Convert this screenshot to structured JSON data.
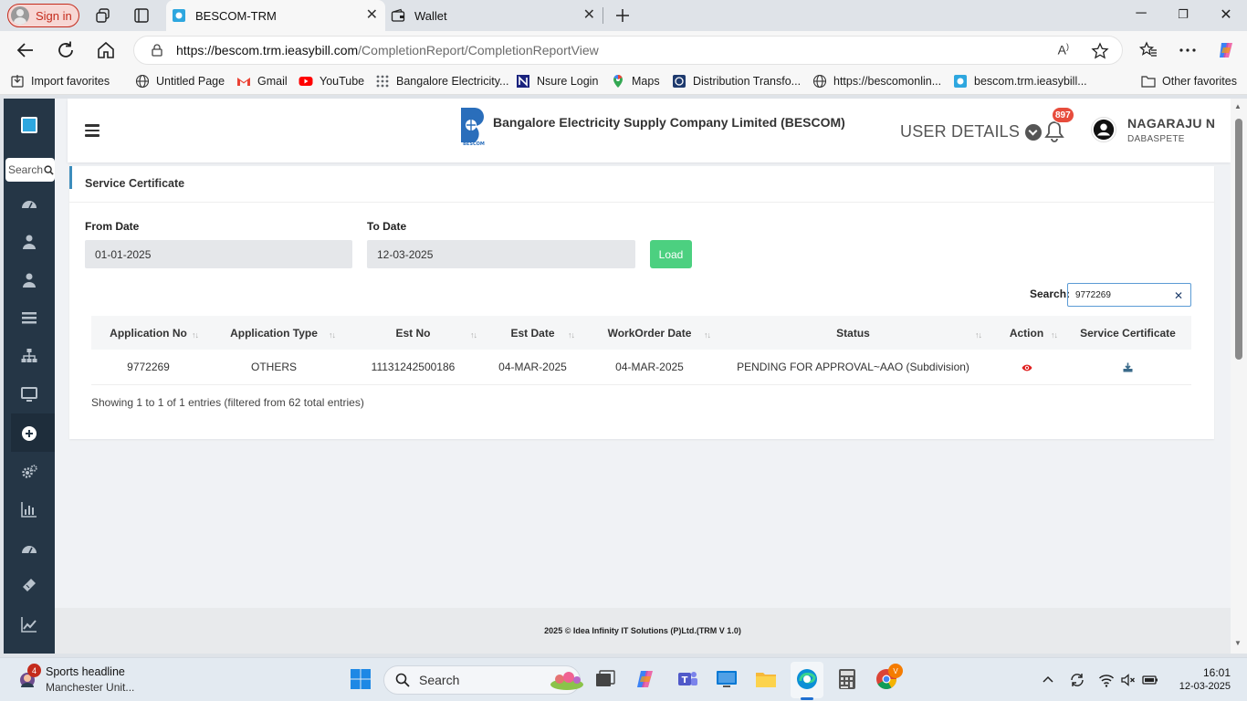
{
  "browser": {
    "signin_label": "Sign in",
    "tabs": [
      {
        "title": "BESCOM-TRM",
        "active": true
      },
      {
        "title": "Wallet",
        "active": false
      }
    ],
    "url_domain": "https://bescom.trm.ieasybill.com",
    "url_path": "/CompletionReport/CompletionReportView",
    "favorites": [
      {
        "label": "Import favorites",
        "icon": "import-icon"
      },
      {
        "label": "Untitled Page",
        "icon": "globe-icon"
      },
      {
        "label": "Gmail",
        "icon": "gmail-icon"
      },
      {
        "label": "YouTube",
        "icon": "youtube-icon"
      },
      {
        "label": "Bangalore Electricity...",
        "icon": "grid-icon"
      },
      {
        "label": "Nsure Login",
        "icon": "nsure-icon"
      },
      {
        "label": "Maps",
        "icon": "maps-icon"
      },
      {
        "label": "Distribution Transfo...",
        "icon": "bescom-icon"
      },
      {
        "label": "https://bescomonlin...",
        "icon": "globe-icon"
      },
      {
        "label": "bescom.trm.ieasybill...",
        "icon": "bescom-icon"
      }
    ],
    "other_favorites": "Other favorites"
  },
  "sidebar": {
    "search_placeholder": "Search",
    "icons": [
      "dashboard-icon",
      "user-icon",
      "user-icon",
      "list-icon",
      "sitemap-icon",
      "monitor-icon",
      "plus-circle-icon",
      "gears-icon",
      "bar-chart-icon",
      "dashboard-icon",
      "ticket-icon",
      "line-chart-icon"
    ]
  },
  "header": {
    "company": "Bangalore Electricity Supply Company Limited (BESCOM)",
    "logo_text": "BESCOM",
    "user_details": "USER DETAILS",
    "notification_count": "897",
    "user_name": "NAGARAJU N",
    "user_location": "DABASPETE"
  },
  "report": {
    "title": "Service Certificate",
    "from_label": "From Date",
    "from_value": "01-01-2025",
    "to_label": "To Date",
    "to_value": "12-03-2025",
    "load_label": "Load",
    "search_label": "Search:",
    "search_value": "9772269",
    "columns": [
      "Application No",
      "Application Type",
      "Est No",
      "Est Date",
      "WorkOrder Date",
      "Status",
      "Action",
      "Service Certificate"
    ],
    "rows": [
      {
        "app_no": "9772269",
        "app_type": "OTHERS",
        "est_no": "11131242500186",
        "est_date": "04-MAR-2025",
        "wo_date": "04-MAR-2025",
        "status": "PENDING FOR APPROVAL~AAO (Subdivision)"
      }
    ],
    "showing": "Showing 1 to 1 of 1 entries (filtered from 62 total entries)"
  },
  "footer": "2025 © Idea Infinity IT Solutions (P)Ltd.(TRM V 1.0)",
  "taskbar": {
    "weather_badge": "4",
    "news_title": "Sports headline",
    "news_sub": "Manchester Unit...",
    "search_placeholder": "Search",
    "chrome_badge": "V",
    "time": "16:01",
    "date": "12-03-2025"
  }
}
